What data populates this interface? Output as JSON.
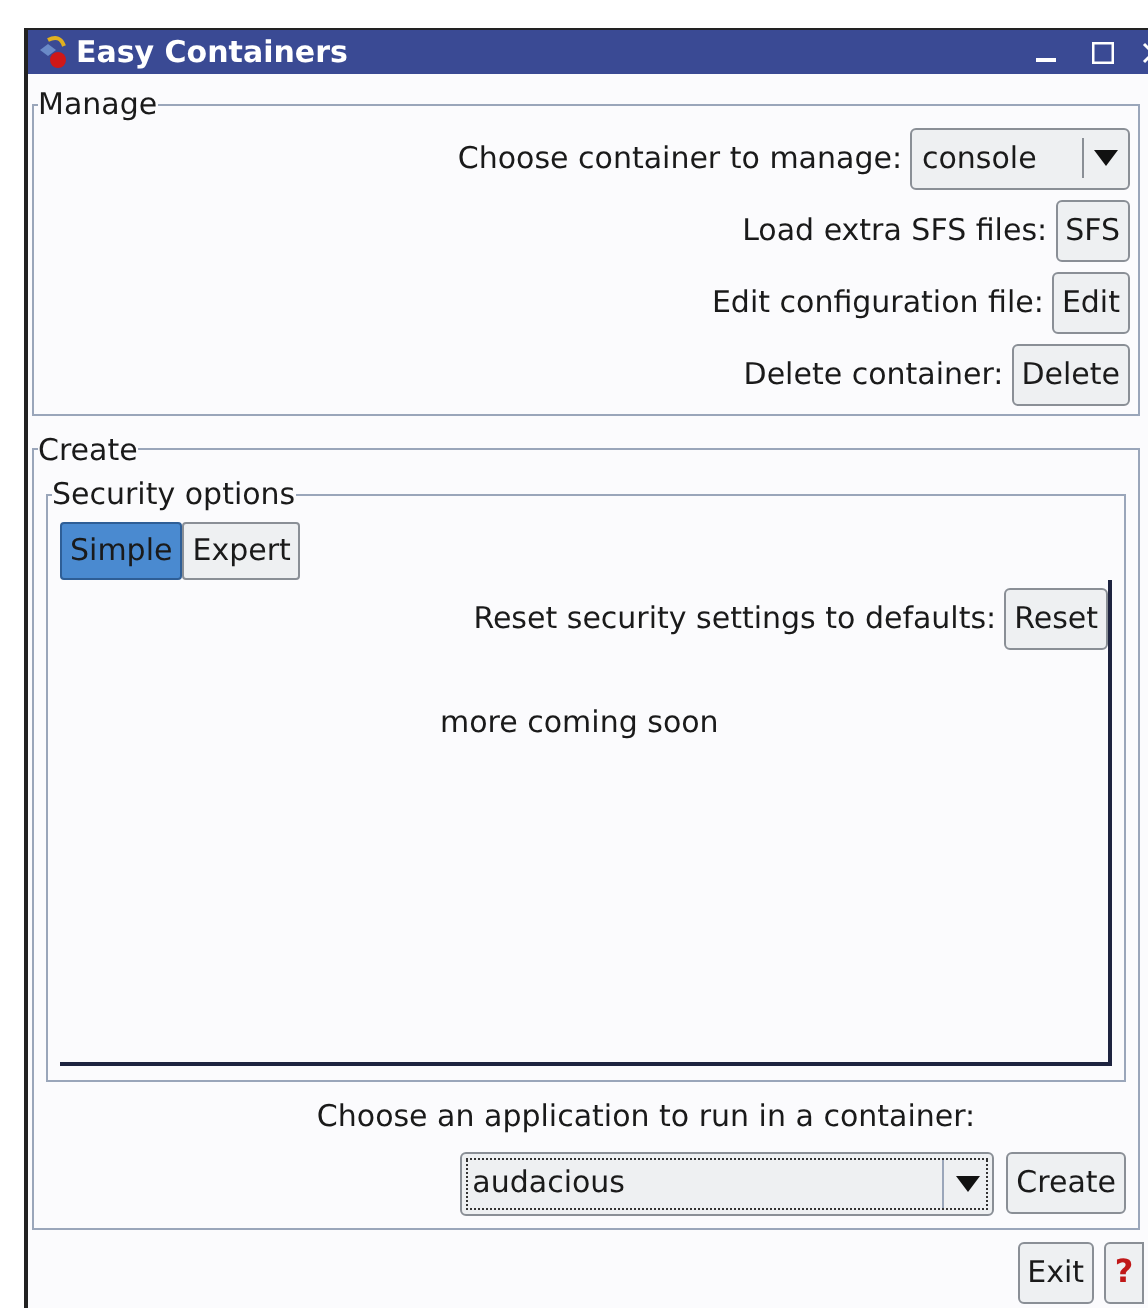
{
  "window": {
    "title": "Easy Containers"
  },
  "manage": {
    "legend": "Manage",
    "rows": [
      {
        "kind": "combo",
        "label": "Choose container to manage:",
        "value": "console"
      },
      {
        "kind": "button",
        "label": "Load extra SFS files:",
        "button": "SFS"
      },
      {
        "kind": "button",
        "label": "Edit configuration file:",
        "button": "Edit"
      },
      {
        "kind": "button",
        "label": "Delete container:",
        "button": "Delete"
      }
    ]
  },
  "create": {
    "legend": "Create",
    "security": {
      "legend": "Security options",
      "tabs": [
        {
          "label": "Simple",
          "selected": true
        },
        {
          "label": "Expert",
          "selected": false
        }
      ],
      "reset_label": "Reset security settings to defaults:",
      "reset_button": "Reset",
      "note": "more coming soon"
    },
    "app_label": "Choose an application to run in a container:",
    "app_value": "audacious",
    "create_button": "Create"
  },
  "buttons": {
    "exit": "Exit",
    "help": "?"
  }
}
